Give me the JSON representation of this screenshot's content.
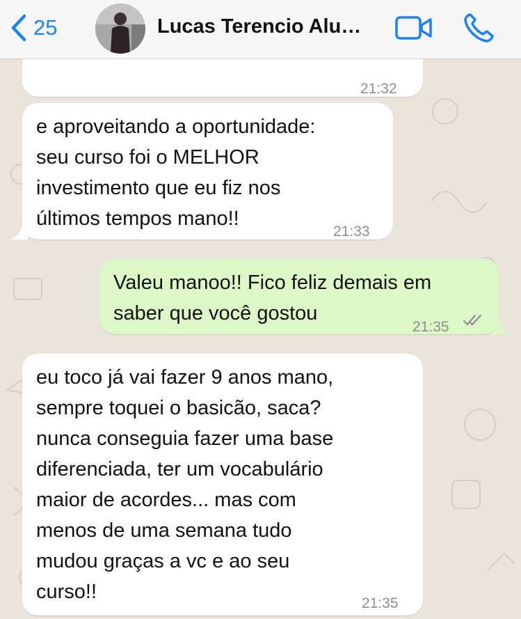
{
  "header": {
    "back_count": "25",
    "contact_name": "Lucas Terencio Alu…",
    "accent_color": "#1a82fb",
    "icons": {
      "back": "chevron-left-icon",
      "video": "video-camera-icon",
      "call": "phone-icon"
    }
  },
  "messages": [
    {
      "direction": "incoming",
      "text": "",
      "time": "21:32"
    },
    {
      "direction": "incoming",
      "text": "e aproveitando a oportunidade:\nseu curso foi o MELHOR\ninvestimento que eu fiz nos\núltimos tempos mano!!",
      "time": "21:33"
    },
    {
      "direction": "outgoing",
      "text": "Valeu manoo!! Fico feliz demais em\nsaber que você gostou",
      "time": "21:35",
      "status": "read"
    },
    {
      "direction": "incoming",
      "text": "eu toco já vai fazer 9 anos mano,\nsempre toquei o basicão, saca?\nnunca conseguia fazer uma base\ndiferenciada, ter um vocabulário\nmaior de acordes... mas com\nmenos de uma semana tudo\nmudou graças a vc e ao seu\ncurso!!",
      "time": "21:35"
    }
  ],
  "colors": {
    "incoming_bubble": "#ffffff",
    "outgoing_bubble": "#dcf8c6",
    "chat_background": "#e9e4dc"
  }
}
